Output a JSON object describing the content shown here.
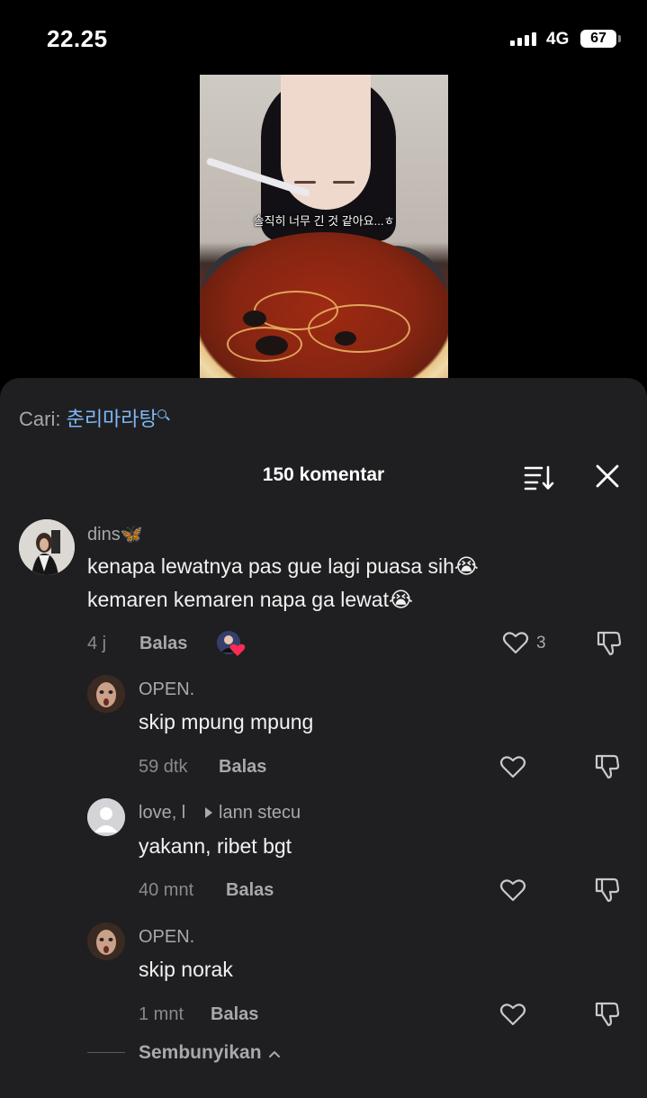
{
  "status_bar": {
    "time": "22.25",
    "network": "4G",
    "battery": "67"
  },
  "video": {
    "subtitle": "솔직히 너무 긴 것 같아요...ㅎ"
  },
  "search": {
    "label": "Cari:",
    "term": "춘리마라탕"
  },
  "header": {
    "comment_count": "150 komentar"
  },
  "comments": [
    {
      "user": "dins🦋",
      "lines": [
        "kenapa lewatnya pas gue lagi puasa sih😭",
        "kemaren kemaren napa ga lewat😭"
      ],
      "time": "4 j",
      "reply": "Balas",
      "likes": "3"
    },
    {
      "user": "OPEN.",
      "text": "skip mpung mpung",
      "time": "59 dtk",
      "reply": "Balas"
    },
    {
      "user": "love, l",
      "reply_to": "lann stecu",
      "text": "yakann, ribet bgt",
      "time": "40 mnt",
      "reply": "Balas"
    },
    {
      "user": "OPEN.",
      "text": "skip norak",
      "time": "1 mnt",
      "reply": "Balas"
    }
  ],
  "footer": {
    "hide_label": "Sembunyikan"
  },
  "colors": {
    "background": "#000000",
    "sheet": "#1f1f21",
    "search_term": "#7fb7f5",
    "muted": "#a9a9ac"
  }
}
